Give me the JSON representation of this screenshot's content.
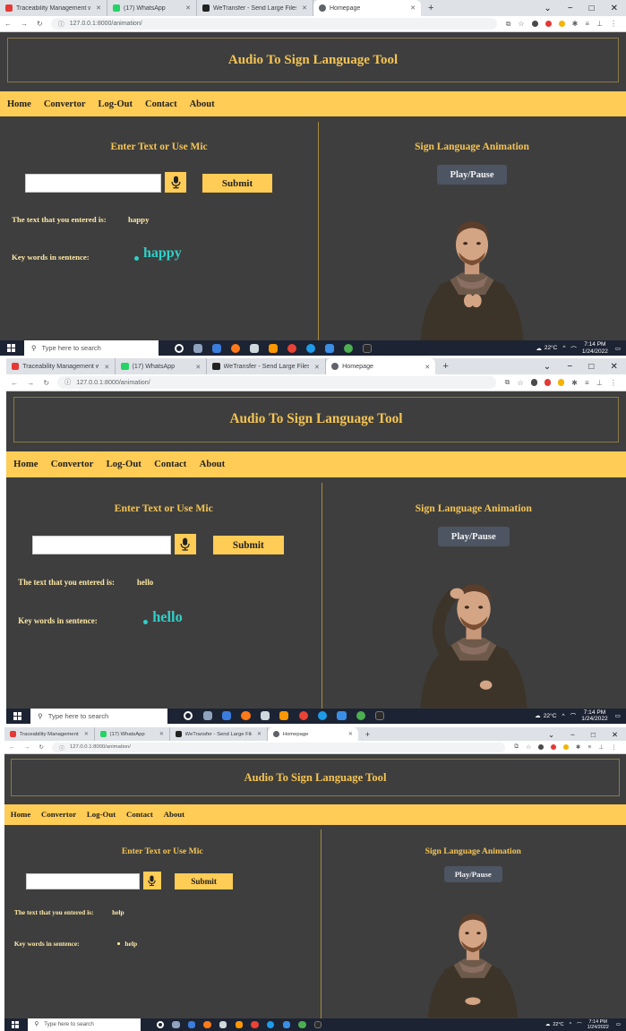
{
  "browser": {
    "tabs": [
      {
        "title": "Traceability Management with In",
        "favicon_color": "#e53935"
      },
      {
        "title": "(17) WhatsApp",
        "favicon_color": "#25d366"
      },
      {
        "title": "WeTransfer - Send Large Files &",
        "favicon_color": "#222222"
      },
      {
        "title": "Homepage",
        "favicon_color": "#5f6368"
      }
    ],
    "new_tab": "+",
    "url": "127.0.0.1:8000/animation/",
    "window_controls": {
      "minimize": "−",
      "maximize": "□",
      "close": "✕"
    }
  },
  "app": {
    "title": "Audio To Sign Language Tool",
    "nav": [
      "Home",
      "Convertor",
      "Log-Out",
      "Contact",
      "About"
    ],
    "left_heading": "Enter Text or Use Mic",
    "submit_label": "Submit",
    "entered_label": "The text that you entered is:",
    "keywords_label": "Key words in sentence:",
    "right_heading": "Sign Language Animation",
    "play_pause_label": "Play/Pause"
  },
  "screenshots": [
    {
      "entered_text": "happy",
      "keyword": "happy",
      "pose": "hands-together"
    },
    {
      "entered_text": "hello",
      "keyword": "hello",
      "pose": "hand-on-head"
    },
    {
      "entered_text": "help",
      "keyword": "help",
      "pose": "hands-low"
    }
  ],
  "taskbar": {
    "search_placeholder": "Type here to search",
    "weather": "22°C",
    "time": "7:14 PM",
    "date": "1/24/2022"
  },
  "colors": {
    "accent": "#ffcc55",
    "title": "#f5c453",
    "keyword": "#2fd0c8",
    "page_bg": "#3e3e3e"
  }
}
